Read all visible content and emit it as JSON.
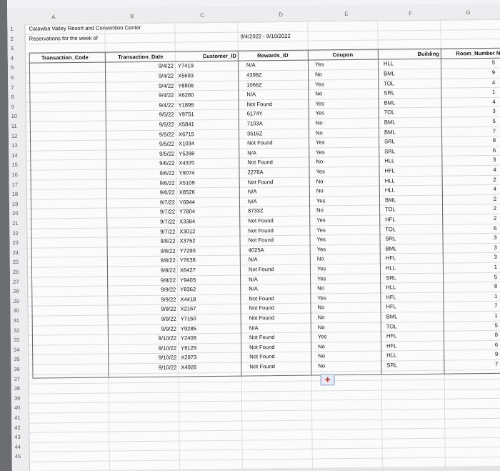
{
  "columns": [
    "A",
    "B",
    "C",
    "D",
    "E",
    "F",
    "G"
  ],
  "title_partial": "Catawba Valley Resort and Convention Center",
  "subtitle_label": "Reservations for the week of",
  "date_range": "9/4/2022 - 9/10/2022",
  "headers": {
    "transaction_code": "Transaction_Code",
    "transaction_date": "Transaction_Date",
    "customer_id": "Customer_ID",
    "rewards_id": "Rewards_ID",
    "coupon": "Coupon",
    "building": "Building",
    "room_number": "Room_Number",
    "next_col_partial": "N"
  },
  "row_numbers": [
    "1",
    "2",
    "3",
    "4",
    "5",
    "6",
    "7",
    "8",
    "9",
    "10",
    "11",
    "12",
    "13",
    "14",
    "15",
    "16",
    "17",
    "18",
    "19",
    "20",
    "21",
    "22",
    "23",
    "24",
    "25",
    "26",
    "27",
    "28",
    "29",
    "30",
    "31",
    "32",
    "33",
    "34",
    "35",
    "36",
    "37",
    "38",
    "39",
    "40",
    "41",
    "42",
    "43",
    "44",
    "45"
  ],
  "rows": [
    {
      "date": "9/4/22",
      "cust": "Y7419",
      "rew": "N/A",
      "coupon": "Yes",
      "bldg": "HLL",
      "room": "5"
    },
    {
      "date": "9/4/22",
      "cust": "X5693",
      "rew": "4398Z",
      "coupon": "No",
      "bldg": "BML",
      "room": "9"
    },
    {
      "date": "9/4/22",
      "cust": "Y8808",
      "rew": "1066Z",
      "coupon": "Yes",
      "bldg": "TOL",
      "room": "4"
    },
    {
      "date": "9/4/22",
      "cust": "X6280",
      "rew": "N/A",
      "coupon": "No",
      "bldg": "SRL",
      "room": "1"
    },
    {
      "date": "9/4/22",
      "cust": "Y1895",
      "rew": "Not Found",
      "coupon": "Yes",
      "bldg": "BML",
      "room": "4"
    },
    {
      "date": "9/5/22",
      "cust": "Y9751",
      "rew": "6174Y",
      "coupon": "Yes",
      "bldg": "TOL",
      "room": "3"
    },
    {
      "date": "9/5/22",
      "cust": "X5841",
      "rew": "7103A",
      "coupon": "No",
      "bldg": "BML",
      "room": "5"
    },
    {
      "date": "9/5/22",
      "cust": "X6715",
      "rew": "3516Z",
      "coupon": "No",
      "bldg": "BML",
      "room": "7"
    },
    {
      "date": "9/5/22",
      "cust": "X1034",
      "rew": "Not Found",
      "coupon": "Yes",
      "bldg": "SRL",
      "room": "8"
    },
    {
      "date": "9/5/22",
      "cust": "Y5288",
      "rew": "N/A",
      "coupon": "Yes",
      "bldg": "SRL",
      "room": "6"
    },
    {
      "date": "9/6/22",
      "cust": "X4370",
      "rew": "Not Found",
      "coupon": "No",
      "bldg": "HLL",
      "room": "3"
    },
    {
      "date": "9/6/22",
      "cust": "Y9074",
      "rew": "2278A",
      "coupon": "Yes",
      "bldg": "HFL",
      "room": "4"
    },
    {
      "date": "9/6/22",
      "cust": "X5109",
      "rew": "Not Found",
      "coupon": "No",
      "bldg": "HLL",
      "room": "2"
    },
    {
      "date": "9/6/22",
      "cust": "X8526",
      "rew": "N/A",
      "coupon": "No",
      "bldg": "HLL",
      "room": "4"
    },
    {
      "date": "9/7/22",
      "cust": "Y6944",
      "rew": "N/A",
      "coupon": "Yes",
      "bldg": "BML",
      "room": "2"
    },
    {
      "date": "9/7/22",
      "cust": "Y7804",
      "rew": "8733Z",
      "coupon": "No",
      "bldg": "TOL",
      "room": "2"
    },
    {
      "date": "9/7/22",
      "cust": "X3384",
      "rew": "Not Found",
      "coupon": "Yes",
      "bldg": "HFL",
      "room": "2"
    },
    {
      "date": "9/7/22",
      "cust": "X3012",
      "rew": "Not Found",
      "coupon": "Yes",
      "bldg": "TOL",
      "room": "6"
    },
    {
      "date": "9/8/22",
      "cust": "X3752",
      "rew": "Not Found",
      "coupon": "Yes",
      "bldg": "SRL",
      "room": "3"
    },
    {
      "date": "9/8/22",
      "cust": "Y7290",
      "rew": "4025A",
      "coupon": "Yes",
      "bldg": "BML",
      "room": "3"
    },
    {
      "date": "9/8/22",
      "cust": "Y7638",
      "rew": "N/A",
      "coupon": "No",
      "bldg": "HFL",
      "room": "3"
    },
    {
      "date": "9/8/22",
      "cust": "X6427",
      "rew": "Not Found",
      "coupon": "Yes",
      "bldg": "HLL",
      "room": "1"
    },
    {
      "date": "9/8/22",
      "cust": "Y9403",
      "rew": "N/A",
      "coupon": "Yes",
      "bldg": "SRL",
      "room": "5"
    },
    {
      "date": "9/9/22",
      "cust": "Y8362",
      "rew": "N/A",
      "coupon": "No",
      "bldg": "HLL",
      "room": "8"
    },
    {
      "date": "9/9/22",
      "cust": "X4418",
      "rew": "Not Found",
      "coupon": "Yes",
      "bldg": "HFL",
      "room": "1"
    },
    {
      "date": "9/9/22",
      "cust": "X2167",
      "rew": "Not Found",
      "coupon": "No",
      "bldg": "HFL",
      "room": "7"
    },
    {
      "date": "9/9/22",
      "cust": "Y7150",
      "rew": "Not Found",
      "coupon": "No",
      "bldg": "BML",
      "room": "1"
    },
    {
      "date": "9/9/22",
      "cust": "Y9285",
      "rew": "N/A",
      "coupon": "No",
      "bldg": "TOL",
      "room": "5"
    },
    {
      "date": "9/10/22",
      "cust": "Y2408",
      "rew": "Not Found",
      "coupon": "Yes",
      "bldg": "HFL",
      "room": "8"
    },
    {
      "date": "9/10/22",
      "cust": "Y8129",
      "rew": "Not Found",
      "coupon": "No",
      "bldg": "HFL",
      "room": "6"
    },
    {
      "date": "9/10/22",
      "cust": "X2873",
      "rew": "Not Found",
      "coupon": "No",
      "bldg": "HLL",
      "room": "9"
    },
    {
      "date": "9/10/22",
      "cust": "X4926",
      "rew": "Not Found",
      "coupon": "No",
      "bldg": "SRL",
      "room": "7"
    }
  ],
  "paste_icon": "paste-options-icon"
}
